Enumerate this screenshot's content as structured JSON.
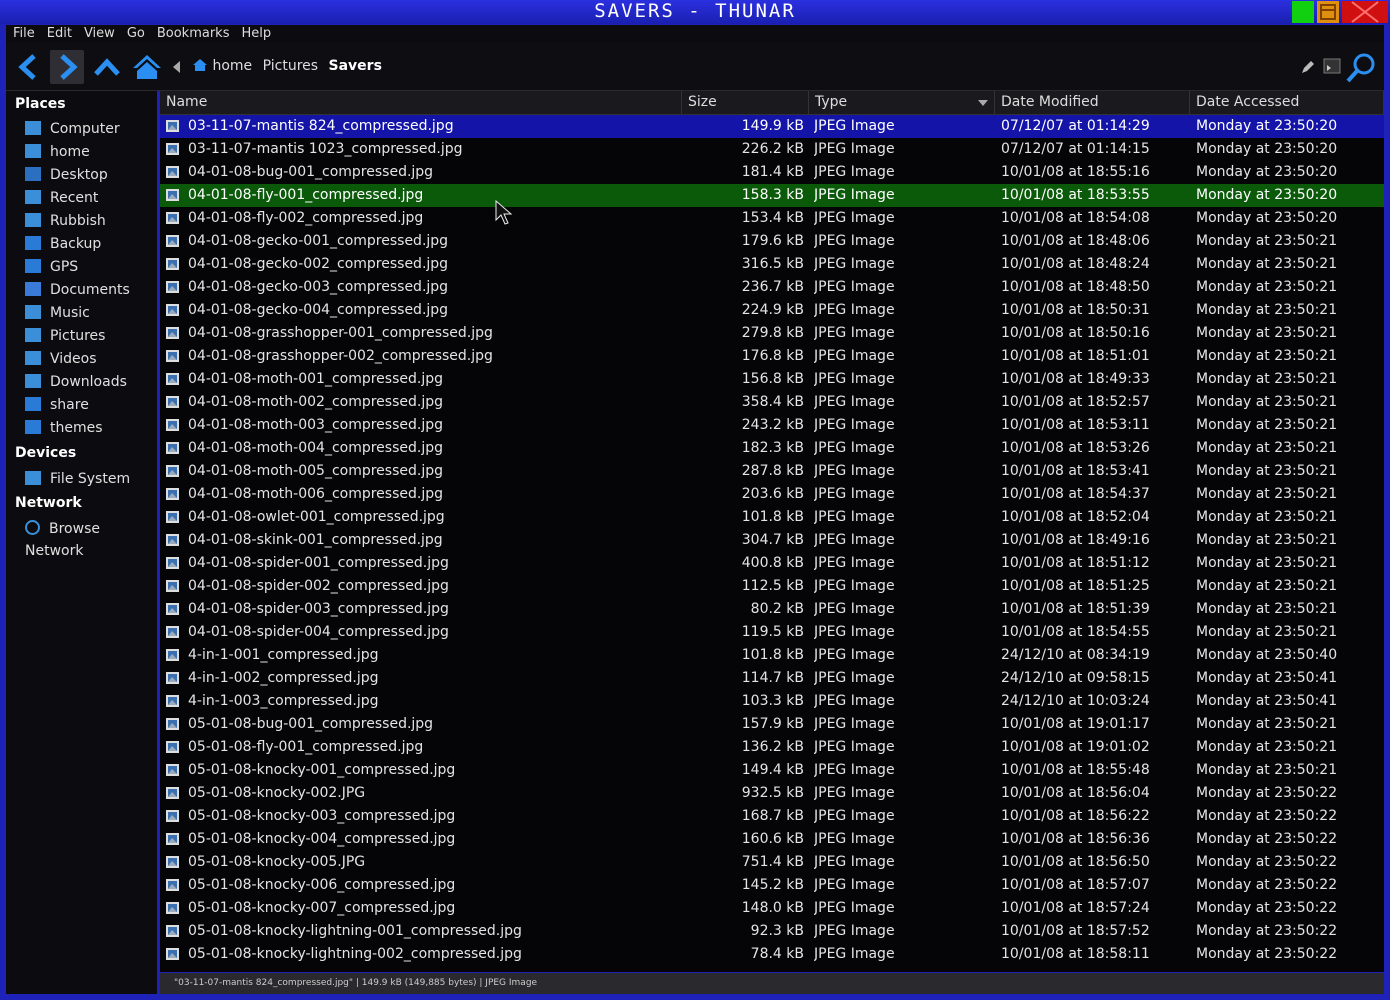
{
  "window": {
    "title": "Savers - Thunar"
  },
  "menu": [
    "File",
    "Edit",
    "View",
    "Go",
    "Bookmarks",
    "Help"
  ],
  "breadcrumb": {
    "home": "home",
    "pictures": "Pictures",
    "current": "Savers"
  },
  "sidebar": {
    "places_title": "Places",
    "places": [
      "Computer",
      "home",
      "Desktop",
      "Recent",
      "Rubbish",
      "Backup",
      "GPS",
      "Documents",
      "Music",
      "Pictures",
      "Videos",
      "Downloads",
      "share",
      "themes"
    ],
    "devices_title": "Devices",
    "devices": [
      "File System"
    ],
    "network_title": "Network",
    "network": [
      "Browse Network"
    ]
  },
  "columns": {
    "name": "Name",
    "size": "Size",
    "type": "Type",
    "modified": "Date Modified",
    "accessed": "Date Accessed"
  },
  "files": [
    [
      "03-11-07-mantis 824_compressed.jpg",
      "149.9 kB",
      "JPEG Image",
      "07/12/07 at 01:14:29",
      "Monday at 23:50:20"
    ],
    [
      "03-11-07-mantis 1023_compressed.jpg",
      "226.2 kB",
      "JPEG Image",
      "07/12/07 at 01:14:15",
      "Monday at 23:50:20"
    ],
    [
      "04-01-08-bug-001_compressed.jpg",
      "181.4 kB",
      "JPEG Image",
      "10/01/08 at 18:55:16",
      "Monday at 23:50:20"
    ],
    [
      "04-01-08-fly-001_compressed.jpg",
      "158.3 kB",
      "JPEG Image",
      "10/01/08 at 18:53:55",
      "Monday at 23:50:20"
    ],
    [
      "04-01-08-fly-002_compressed.jpg",
      "153.4 kB",
      "JPEG Image",
      "10/01/08 at 18:54:08",
      "Monday at 23:50:20"
    ],
    [
      "04-01-08-gecko-001_compressed.jpg",
      "179.6 kB",
      "JPEG Image",
      "10/01/08 at 18:48:06",
      "Monday at 23:50:21"
    ],
    [
      "04-01-08-gecko-002_compressed.jpg",
      "316.5 kB",
      "JPEG Image",
      "10/01/08 at 18:48:24",
      "Monday at 23:50:21"
    ],
    [
      "04-01-08-gecko-003_compressed.jpg",
      "236.7 kB",
      "JPEG Image",
      "10/01/08 at 18:48:50",
      "Monday at 23:50:21"
    ],
    [
      "04-01-08-gecko-004_compressed.jpg",
      "224.9 kB",
      "JPEG Image",
      "10/01/08 at 18:50:31",
      "Monday at 23:50:21"
    ],
    [
      "04-01-08-grasshopper-001_compressed.jpg",
      "279.8 kB",
      "JPEG Image",
      "10/01/08 at 18:50:16",
      "Monday at 23:50:21"
    ],
    [
      "04-01-08-grasshopper-002_compressed.jpg",
      "176.8 kB",
      "JPEG Image",
      "10/01/08 at 18:51:01",
      "Monday at 23:50:21"
    ],
    [
      "04-01-08-moth-001_compressed.jpg",
      "156.8 kB",
      "JPEG Image",
      "10/01/08 at 18:49:33",
      "Monday at 23:50:21"
    ],
    [
      "04-01-08-moth-002_compressed.jpg",
      "358.4 kB",
      "JPEG Image",
      "10/01/08 at 18:52:57",
      "Monday at 23:50:21"
    ],
    [
      "04-01-08-moth-003_compressed.jpg",
      "243.2 kB",
      "JPEG Image",
      "10/01/08 at 18:53:11",
      "Monday at 23:50:21"
    ],
    [
      "04-01-08-moth-004_compressed.jpg",
      "182.3 kB",
      "JPEG Image",
      "10/01/08 at 18:53:26",
      "Monday at 23:50:21"
    ],
    [
      "04-01-08-moth-005_compressed.jpg",
      "287.8 kB",
      "JPEG Image",
      "10/01/08 at 18:53:41",
      "Monday at 23:50:21"
    ],
    [
      "04-01-08-moth-006_compressed.jpg",
      "203.6 kB",
      "JPEG Image",
      "10/01/08 at 18:54:37",
      "Monday at 23:50:21"
    ],
    [
      "04-01-08-owlet-001_compressed.jpg",
      "101.8 kB",
      "JPEG Image",
      "10/01/08 at 18:52:04",
      "Monday at 23:50:21"
    ],
    [
      "04-01-08-skink-001_compressed.jpg",
      "304.7 kB",
      "JPEG Image",
      "10/01/08 at 18:49:16",
      "Monday at 23:50:21"
    ],
    [
      "04-01-08-spider-001_compressed.jpg",
      "400.8 kB",
      "JPEG Image",
      "10/01/08 at 18:51:12",
      "Monday at 23:50:21"
    ],
    [
      "04-01-08-spider-002_compressed.jpg",
      "112.5 kB",
      "JPEG Image",
      "10/01/08 at 18:51:25",
      "Monday at 23:50:21"
    ],
    [
      "04-01-08-spider-003_compressed.jpg",
      "80.2 kB",
      "JPEG Image",
      "10/01/08 at 18:51:39",
      "Monday at 23:50:21"
    ],
    [
      "04-01-08-spider-004_compressed.jpg",
      "119.5 kB",
      "JPEG Image",
      "10/01/08 at 18:54:55",
      "Monday at 23:50:21"
    ],
    [
      "4-in-1-001_compressed.jpg",
      "101.8 kB",
      "JPEG Image",
      "24/12/10 at 08:34:19",
      "Monday at 23:50:40"
    ],
    [
      "4-in-1-002_compressed.jpg",
      "114.7 kB",
      "JPEG Image",
      "24/12/10 at 09:58:15",
      "Monday at 23:50:41"
    ],
    [
      "4-in-1-003_compressed.jpg",
      "103.3 kB",
      "JPEG Image",
      "24/12/10 at 10:03:24",
      "Monday at 23:50:41"
    ],
    [
      "05-01-08-bug-001_compressed.jpg",
      "157.9 kB",
      "JPEG Image",
      "10/01/08 at 19:01:17",
      "Monday at 23:50:21"
    ],
    [
      "05-01-08-fly-001_compressed.jpg",
      "136.2 kB",
      "JPEG Image",
      "10/01/08 at 19:01:02",
      "Monday at 23:50:21"
    ],
    [
      "05-01-08-knocky-001_compressed.jpg",
      "149.4 kB",
      "JPEG Image",
      "10/01/08 at 18:55:48",
      "Monday at 23:50:21"
    ],
    [
      "05-01-08-knocky-002.JPG",
      "932.5 kB",
      "JPEG Image",
      "10/01/08 at 18:56:04",
      "Monday at 23:50:22"
    ],
    [
      "05-01-08-knocky-003_compressed.jpg",
      "168.7 kB",
      "JPEG Image",
      "10/01/08 at 18:56:22",
      "Monday at 23:50:22"
    ],
    [
      "05-01-08-knocky-004_compressed.jpg",
      "160.6 kB",
      "JPEG Image",
      "10/01/08 at 18:56:36",
      "Monday at 23:50:22"
    ],
    [
      "05-01-08-knocky-005.JPG",
      "751.4 kB",
      "JPEG Image",
      "10/01/08 at 18:56:50",
      "Monday at 23:50:22"
    ],
    [
      "05-01-08-knocky-006_compressed.jpg",
      "145.2 kB",
      "JPEG Image",
      "10/01/08 at 18:57:07",
      "Monday at 23:50:22"
    ],
    [
      "05-01-08-knocky-007_compressed.jpg",
      "148.0 kB",
      "JPEG Image",
      "10/01/08 at 18:57:24",
      "Monday at 23:50:22"
    ],
    [
      "05-01-08-knocky-lightning-001_compressed.jpg",
      "92.3 kB",
      "JPEG Image",
      "10/01/08 at 18:57:52",
      "Monday at 23:50:22"
    ],
    [
      "05-01-08-knocky-lightning-002_compressed.jpg",
      "78.4 kB",
      "JPEG Image",
      "10/01/08 at 18:58:11",
      "Monday at 23:50:22"
    ]
  ],
  "selected_index": 0,
  "hover_index": 3,
  "status": "\"03-11-07-mantis 824_compressed.jpg\" | 149.9 kB (149,885 bytes) | JPEG Image",
  "colors": {
    "selection": "#1414a8",
    "hover": "#0a5a0a",
    "accent": "#1f7fd8"
  }
}
